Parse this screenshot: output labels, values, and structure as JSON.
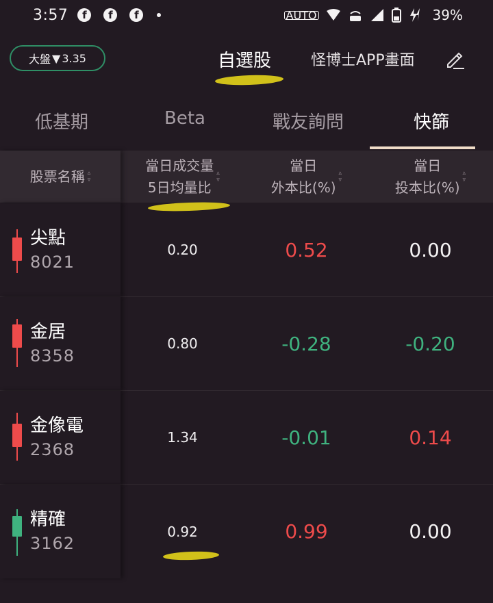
{
  "status_bar": {
    "time": "3:57",
    "notification_icons": [
      "facebook-icon",
      "facebook-icon",
      "facebook-icon"
    ],
    "auto_label": "AUTO",
    "battery_percent": "39%"
  },
  "header": {
    "market_badge_label": "大盤",
    "market_badge_arrow": "▼",
    "market_badge_value": "3.35",
    "title": "自選股",
    "subtitle": "怪博士APP畫面"
  },
  "tabs": [
    {
      "label": "低基期",
      "active": false
    },
    {
      "label": "Beta",
      "active": false
    },
    {
      "label": "戰友詢問",
      "active": false
    },
    {
      "label": "快篩",
      "active": true
    }
  ],
  "table": {
    "headers": {
      "name": "股票名稱",
      "volume_line1": "當日成交量",
      "volume_line2": "5日均量比",
      "foreign_line1": "當日",
      "foreign_line2": "外本比(%)",
      "trust_line1": "當日",
      "trust_line2": "投本比(%)"
    },
    "rows": [
      {
        "name": "尖點",
        "code": "8021",
        "candle": "red",
        "volume_ratio": "0.20",
        "foreign": "0.52",
        "foreign_sign": "pos",
        "trust": "0.00",
        "trust_sign": "zero"
      },
      {
        "name": "金居",
        "code": "8358",
        "candle": "red",
        "volume_ratio": "0.80",
        "foreign": "-0.28",
        "foreign_sign": "neg",
        "trust": "-0.20",
        "trust_sign": "neg"
      },
      {
        "name": "金像電",
        "code": "2368",
        "candle": "red",
        "volume_ratio": "1.34",
        "foreign": "-0.01",
        "foreign_sign": "neg",
        "trust": "0.14",
        "trust_sign": "pos"
      },
      {
        "name": "精確",
        "code": "3162",
        "candle": "green",
        "volume_ratio": "0.92",
        "foreign": "0.99",
        "foreign_sign": "pos",
        "trust": "0.00",
        "trust_sign": "zero"
      }
    ]
  },
  "colors": {
    "background": "#221a22",
    "up_red": "#ee4b4b",
    "down_green": "#3fb27f",
    "badge_border": "#2f8f66",
    "highlight_marker": "#e4d41a",
    "tab_underline": "#f0dcc8"
  }
}
